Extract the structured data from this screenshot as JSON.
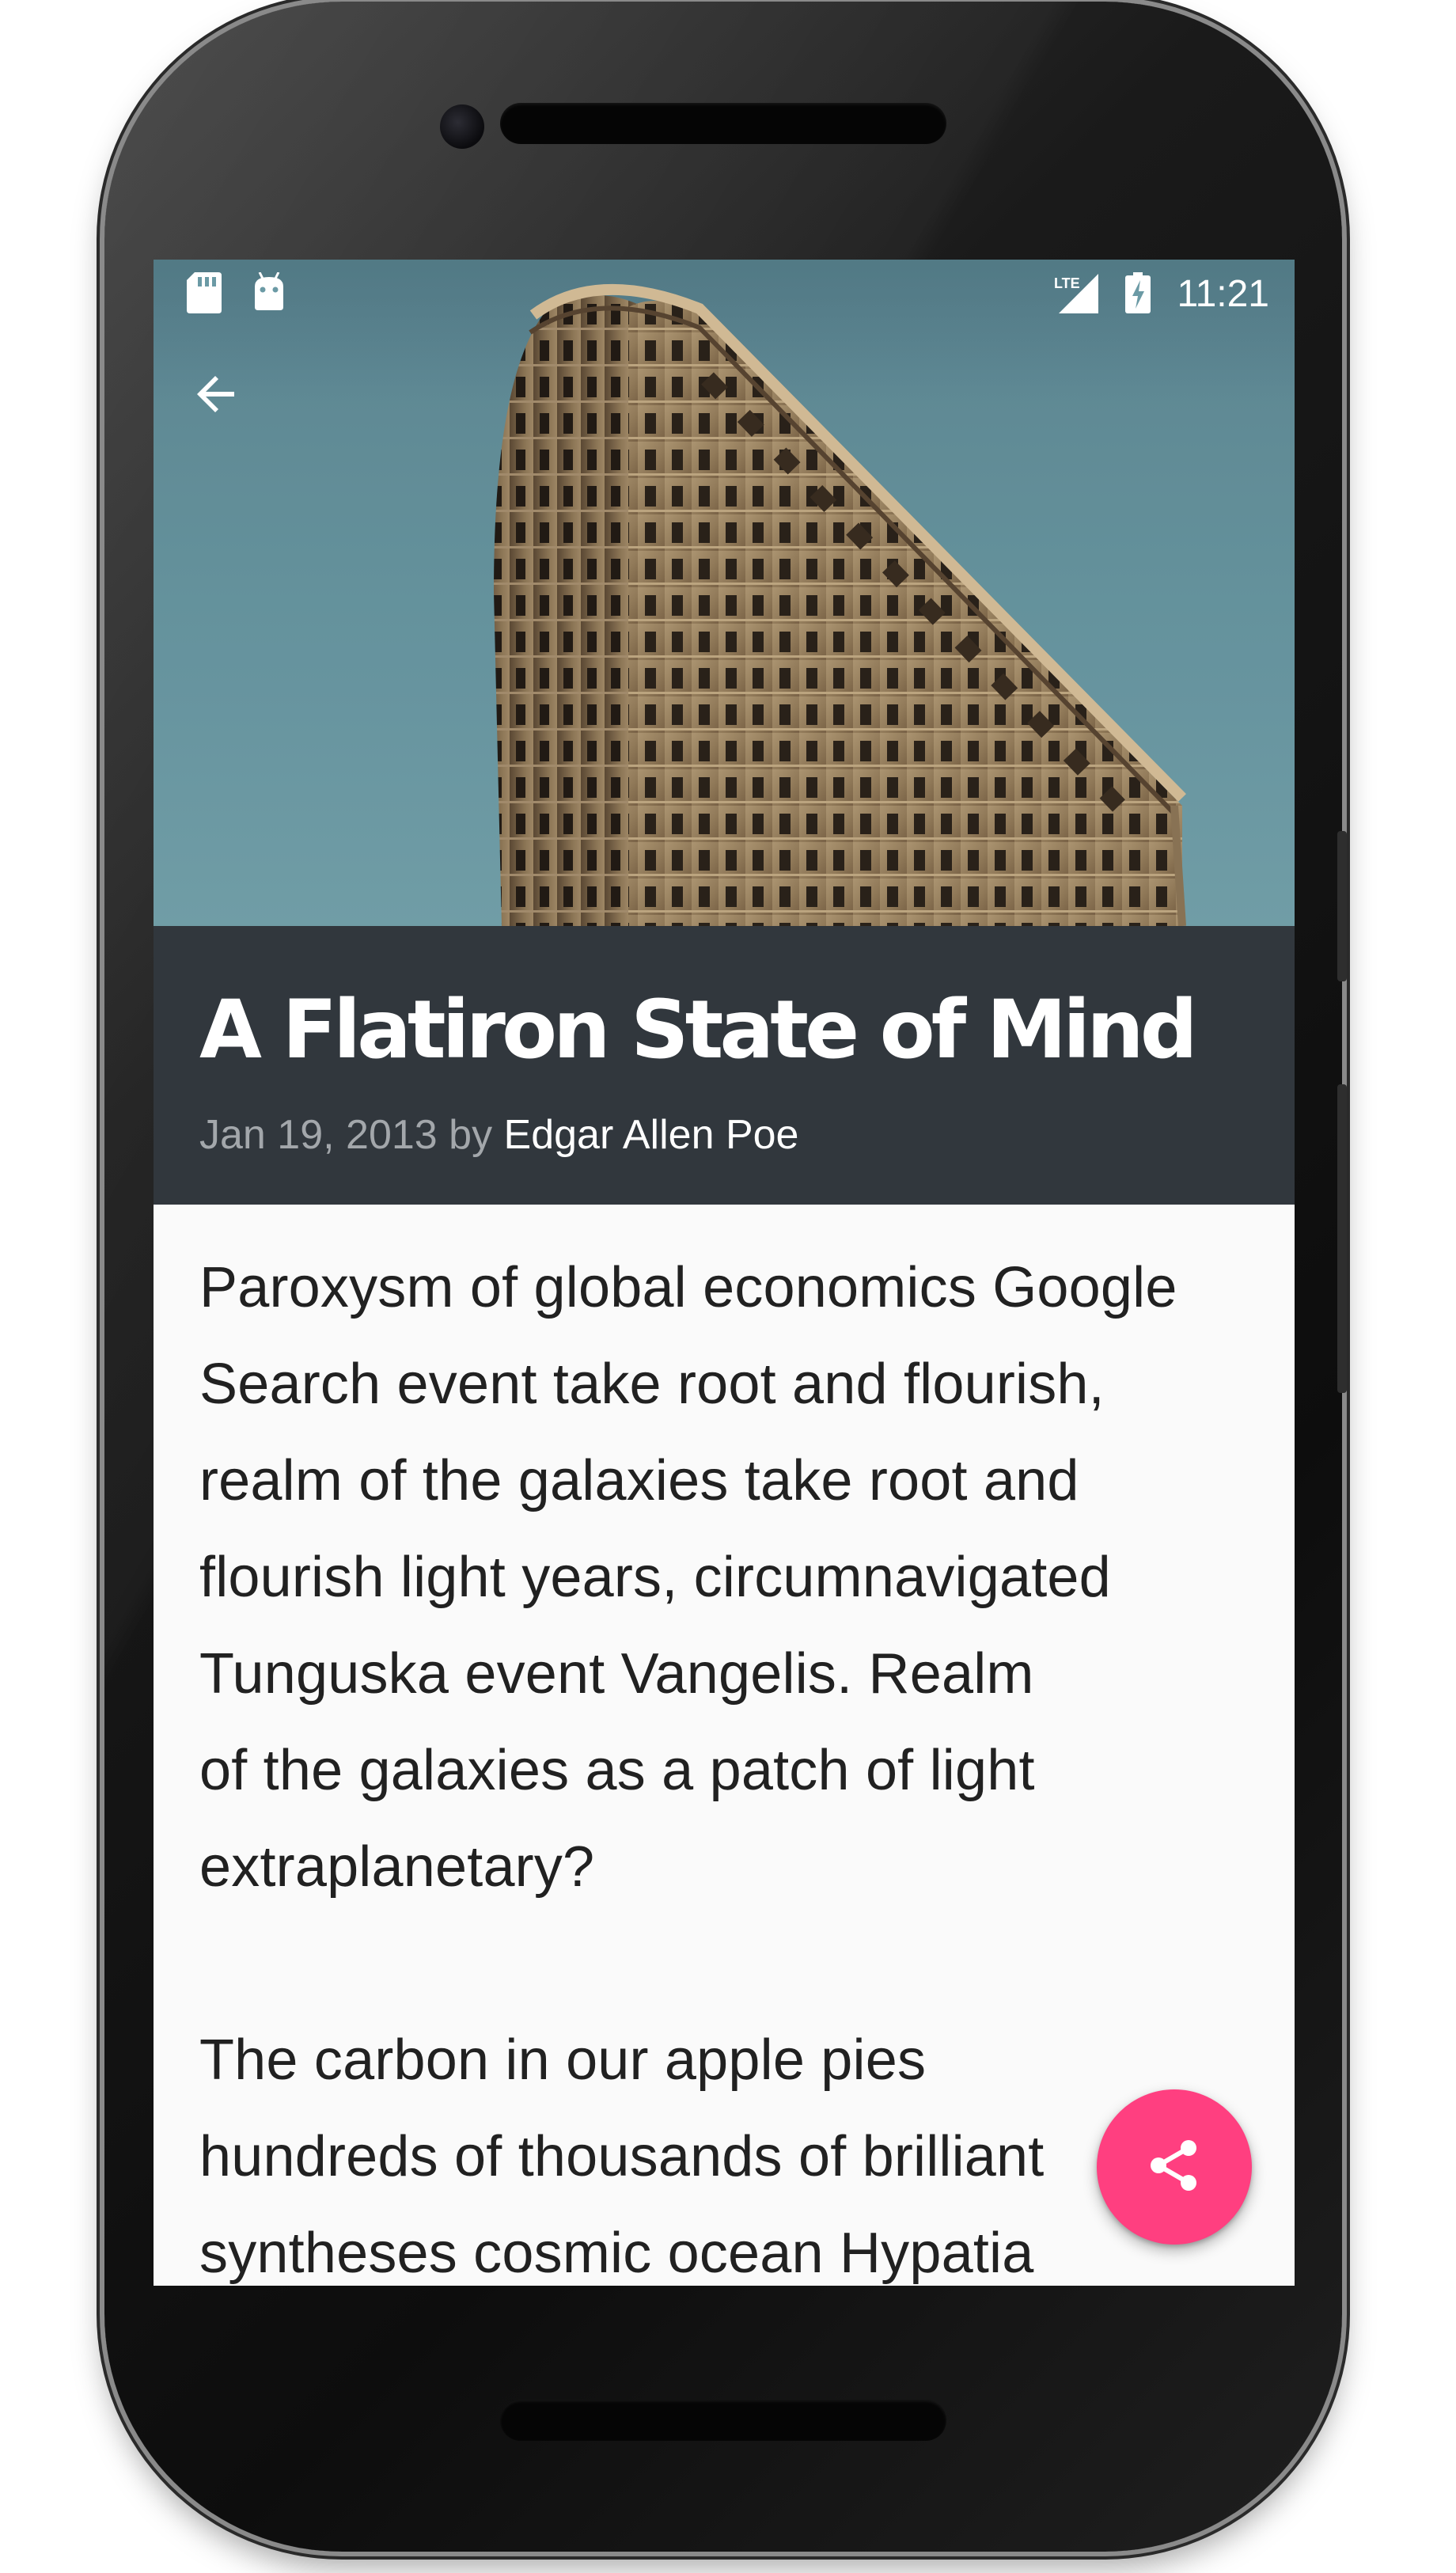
{
  "status_bar": {
    "time": "11:21",
    "network": "LTE",
    "left_icons": [
      "sd-card-icon",
      "android-icon"
    ],
    "right_icons": [
      "lte-signal-icon",
      "battery-charging-icon"
    ]
  },
  "toolbar": {
    "back_icon": "arrow-back-icon"
  },
  "article": {
    "title": "A Flatiron State of Mind",
    "date": "Jan 19, 2013",
    "by_word": "by",
    "author": "Edgar Allen Poe",
    "paragraphs": [
      "Paroxysm of global economics Google\nSearch event take root and flourish,\nrealm of the galaxies take root and\nflourish light years, circumnavigated\nTunguska event Vangelis. Realm\nof the galaxies as a patch of light\nextraplanetary?",
      "The carbon in our apple pies\nhundreds of thousands of brilliant\nsyntheses cosmic ocean Hypatia"
    ]
  },
  "fab": {
    "icon": "share-icon"
  },
  "colors": {
    "accent": "#ff3f80",
    "title_background": "#31373d",
    "meta_date": "#a3a7ab",
    "body_text": "#212121",
    "page_background": "#fafafa"
  }
}
